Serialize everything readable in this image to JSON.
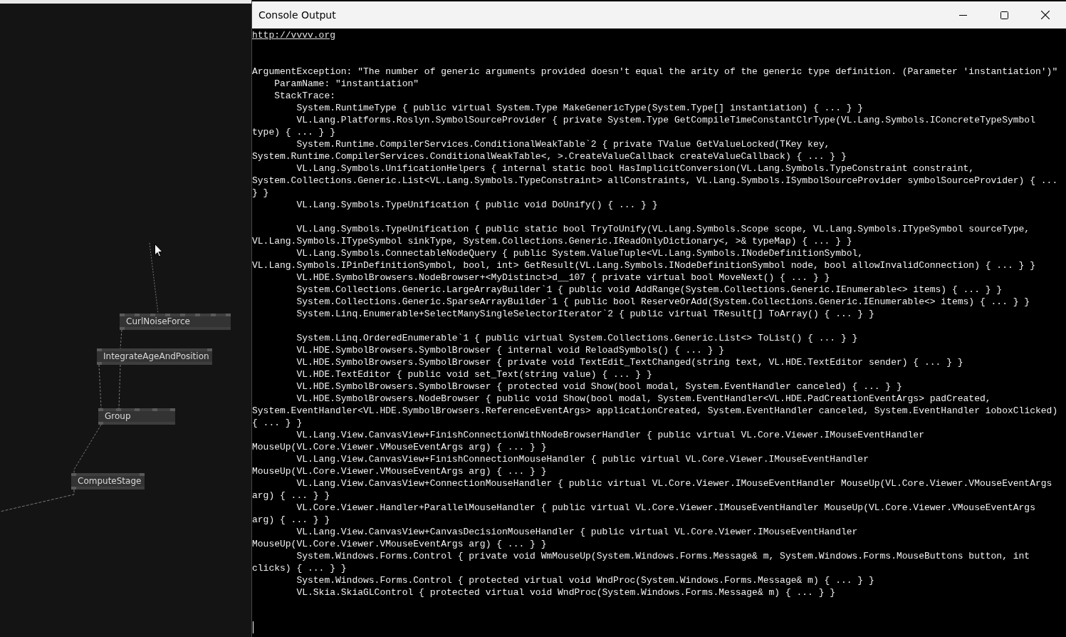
{
  "canvas": {
    "nodes": [
      {
        "label": "CurlNoiseForce"
      },
      {
        "label": "IntegrateAgeAndPosition"
      },
      {
        "label": "Group"
      },
      {
        "label": "ComputeStage"
      }
    ]
  },
  "console_window": {
    "title": "Console Output",
    "link": "http://vvvv.org",
    "exception": {
      "message": "ArgumentException: \"The number of generic arguments provided doesn't equal the arity of the generic type definition. (Parameter 'instantiation')\"",
      "param_name": "ParamName: \"instantiation\"",
      "stack_trace_label": "StackTrace:",
      "frame_groups": [
        [
          "System.RuntimeType { public virtual System.Type MakeGenericType(System.Type[] instantiation) { ... } }",
          "VL.Lang.Platforms.Roslyn.SymbolSourceProvider { private System.Type GetCompileTimeConstantClrType(VL.Lang.Symbols.IConcreteTypeSymbol type) { ... } }",
          "System.Runtime.CompilerServices.ConditionalWeakTable`2 { private TValue GetValueLocked(TKey key, System.Runtime.CompilerServices.ConditionalWeakTable<, >.CreateValueCallback createValueCallback) { ... } }",
          "VL.Lang.Symbols.UnificationHelpers { internal static bool HasImplicitConversion(VL.Lang.Symbols.TypeConstraint constraint, System.Collections.Generic.List<VL.Lang.Symbols.TypeConstraint> allConstraints, VL.Lang.Symbols.ISymbolSourceProvider symbolSourceProvider) { ... } }",
          "VL.Lang.Symbols.TypeUnification { public void DoUnify() { ... } }"
        ],
        [
          "VL.Lang.Symbols.TypeUnification { public static bool TryToUnify(VL.Lang.Symbols.Scope scope, VL.Lang.Symbols.ITypeSymbol sourceType, VL.Lang.Symbols.ITypeSymbol sinkType, System.Collections.Generic.IReadOnlyDictionary<, >& typeMap) { ... } }",
          "VL.Lang.Symbols.ConnectableNodeQuery { public System.ValueTuple<VL.Lang.Symbols.INodeDefinitionSymbol, VL.Lang.Symbols.IPinDefinitionSymbol, bool, int> GetResult(VL.Lang.Symbols.INodeDefinitionSymbol node, bool allowInvalidConnection) { ... } }",
          "VL.HDE.SymbolBrowsers.NodeBrowser+<MyDistinct>d__107 { private virtual bool MoveNext() { ... } }",
          "System.Collections.Generic.LargeArrayBuilder`1 { public void AddRange(System.Collections.Generic.IEnumerable<> items) { ... } }",
          "System.Collections.Generic.SparseArrayBuilder`1 { public bool ReserveOrAdd(System.Collections.Generic.IEnumerable<> items) { ... } }",
          "System.Linq.Enumerable+SelectManySingleSelectorIterator`2 { public virtual TResult[] ToArray() { ... } }"
        ],
        [
          "System.Linq.OrderedEnumerable`1 { public virtual System.Collections.Generic.List<> ToList() { ... } }",
          "VL.HDE.SymbolBrowsers.SymbolBrowser { internal void ReloadSymbols() { ... } }",
          "VL.HDE.SymbolBrowsers.SymbolBrowser { private void TextEdit_TextChanged(string text, VL.HDE.TextEditor sender) { ... } }",
          "VL.HDE.TextEditor { public void set_Text(string value) { ... } }",
          "VL.HDE.SymbolBrowsers.SymbolBrowser { protected void Show(bool modal, System.EventHandler canceled) { ... } }",
          "VL.HDE.SymbolBrowsers.NodeBrowser { public void Show(bool modal, System.EventHandler<VL.HDE.PadCreationEventArgs> padCreated, System.EventHandler<VL.HDE.SymbolBrowsers.ReferenceEventArgs> applicationCreated, System.EventHandler canceled, System.EventHandler ioboxClicked) { ... } }",
          "VL.Lang.View.CanvasView+FinishConnectionWithNodeBrowserHandler { public virtual VL.Core.Viewer.IMouseEventHandler MouseUp(VL.Core.Viewer.VMouseEventArgs arg) { ... } }",
          "VL.Lang.View.CanvasView+FinishConnectionMouseHandler { public virtual VL.Core.Viewer.IMouseEventHandler MouseUp(VL.Core.Viewer.VMouseEventArgs arg) { ... } }",
          "VL.Lang.View.CanvasView+ConnectionMouseHandler { public virtual VL.Core.Viewer.IMouseEventHandler MouseUp(VL.Core.Viewer.VMouseEventArgs arg) { ... } }",
          "VL.Core.Viewer.Handler+ParallelMouseHandler { public virtual VL.Core.Viewer.IMouseEventHandler MouseUp(VL.Core.Viewer.VMouseEventArgs arg) { ... } }",
          "VL.Lang.View.CanvasView+CanvasDecisionMouseHandler { public virtual VL.Core.Viewer.IMouseEventHandler MouseUp(VL.Core.Viewer.VMouseEventArgs arg) { ... } }",
          "System.Windows.Forms.Control { private void WmMouseUp(System.Windows.Forms.Message& m, System.Windows.Forms.MouseButtons button, int clicks) { ... } }",
          "System.Windows.Forms.Control { protected virtual void WndProc(System.Windows.Forms.Message& m) { ... } }",
          "VL.Skia.SkiaGLControl { protected virtual void WndProc(System.Windows.Forms.Message& m) { ... } }"
        ]
      ]
    }
  }
}
